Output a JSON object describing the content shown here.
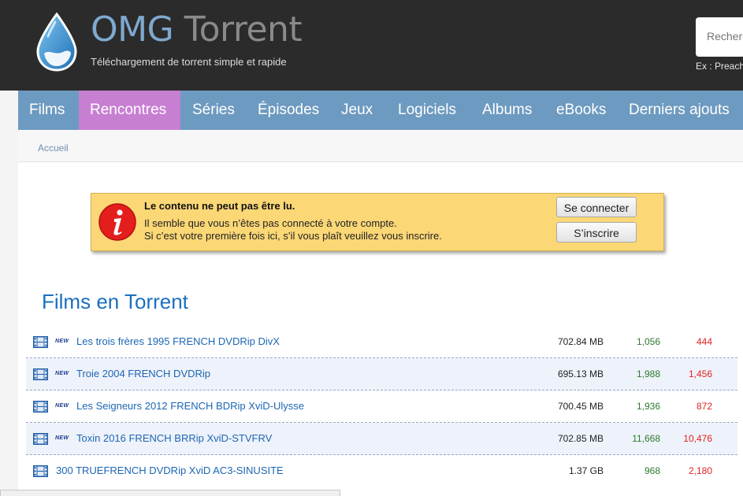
{
  "header": {
    "logo_part1": "OMG",
    "logo_part2": "Torrent",
    "tagline": "Téléchargement de torrent simple et rapide",
    "search_placeholder": "Recherche",
    "search_example": "Ex : Preacher"
  },
  "nav": {
    "items": [
      {
        "label": "Films"
      },
      {
        "label": "Rencontres",
        "active": true
      },
      {
        "label": "Séries"
      },
      {
        "label": "Épisodes"
      },
      {
        "label": "Jeux"
      },
      {
        "label": "Logiciels"
      },
      {
        "label": "Albums"
      },
      {
        "label": "eBooks"
      },
      {
        "label": "Derniers ajouts"
      }
    ]
  },
  "breadcrumb": {
    "home": "Accueil"
  },
  "alert": {
    "title": "Le contenu ne peut pas être lu.",
    "line1": "Il semble que vous n’êtes pas connecté à votre compte.",
    "line2": "Si c’est votre première fois ici, s’il vous plaît veuillez vous inscrire.",
    "login_label": "Se connecter",
    "signup_label": "S’inscrire",
    "icon": "info-icon"
  },
  "section_title": "Films en Torrent",
  "new_badge": "NEW",
  "torrents": [
    {
      "title": "Les trois frères 1995 FRENCH DVDRip DivX",
      "size": "702.84 MB",
      "seeds": "1,056",
      "leechers": "444",
      "is_new": true
    },
    {
      "title": "Troie 2004 FRENCH DVDRip",
      "size": "695.13 MB",
      "seeds": "1,988",
      "leechers": "1,456",
      "is_new": true
    },
    {
      "title": "Les Seigneurs 2012 FRENCH BDRip XviD-Ulysse",
      "size": "700.45 MB",
      "seeds": "1,936",
      "leechers": "872",
      "is_new": true
    },
    {
      "title": "Toxin 2016 FRENCH BRRip XviD-STVFRV",
      "size": "702.85 MB",
      "seeds": "11,668",
      "leechers": "10,476",
      "is_new": true
    },
    {
      "title": "300 TRUEFRENCH DVDRip XviD AC3-SINUSITE",
      "size": "1.37 GB",
      "seeds": "968",
      "leechers": "2,180",
      "is_new": false
    }
  ],
  "colors": {
    "header_bg": "#2b2b2b",
    "nav_bg": "#6d9ac0",
    "nav_active": "#c77fd2",
    "link": "#1c66b3",
    "seeds": "#2d7a2d",
    "leechers": "#e32222",
    "alert_bg": "#fbd776"
  }
}
